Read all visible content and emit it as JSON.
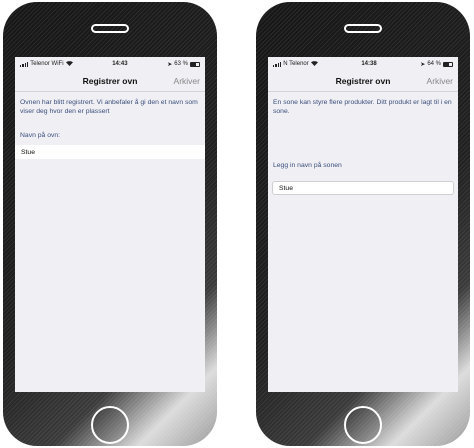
{
  "left_screen": {
    "status": {
      "carrier": "Telenor WiFi",
      "time": "14:43",
      "battery": "63 %",
      "battery_level": 0.63
    },
    "nav": {
      "title": "Registrer ovn",
      "action": "Arkiver"
    },
    "message": "Ovnen har blitt registrert. Vi anbefaler å gi den et navn som viser deg hvor den er plassert",
    "field_label": "Navn på ovn:",
    "field_value": "Stue"
  },
  "right_screen": {
    "status": {
      "carrier": "N Telenor",
      "time": "14:38",
      "battery": "64 %",
      "battery_level": 0.64
    },
    "nav": {
      "title": "Registrer ovn",
      "action": "Arkiver"
    },
    "message": "En sone kan styre flere produkter. Ditt produkt er lagt til i en sone.",
    "field_label": "Legg in navn på sonen",
    "field_value": "Stue"
  },
  "colors": {
    "screen_bg": "#efeff4",
    "text_blue": "#3b4f7a",
    "nav_action": "#888888",
    "phone_body": "#161616"
  },
  "icons": [
    "signal-icon",
    "wifi-icon",
    "location-icon",
    "battery-icon",
    "speaker-grille-icon",
    "home-button-icon"
  ]
}
